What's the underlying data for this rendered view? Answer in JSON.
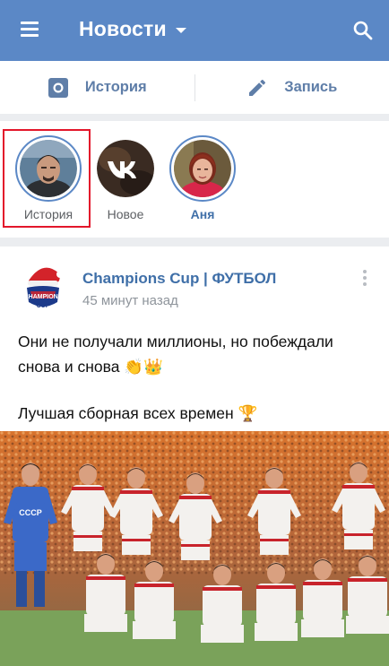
{
  "header": {
    "title": "Новости"
  },
  "actions": {
    "story_label": "История",
    "post_label": "Запись"
  },
  "stories": [
    {
      "label": "История"
    },
    {
      "label": "Новое"
    },
    {
      "label": "Аня"
    }
  ],
  "post": {
    "author": "Champions Cup | ФУТБОЛ",
    "time": "45 минут назад",
    "text_line1": "Они не получали миллионы, но побеждали снова и снова",
    "text_emoji1": "👏👑",
    "text_line2": "Лучшая сборная всех времен",
    "text_emoji2": "🏆",
    "jersey_text": "СССР"
  },
  "colors": {
    "header_bg": "#5b88c6",
    "link_blue": "#3f6fa8",
    "highlight_red": "#e3162b"
  },
  "icons": {
    "menu": "hamburger-icon",
    "title_caret": "chevron-down-icon",
    "search": "search-icon",
    "story_action": "camera-icon",
    "post_action": "pencil-icon",
    "more": "more-vertical-icon"
  }
}
